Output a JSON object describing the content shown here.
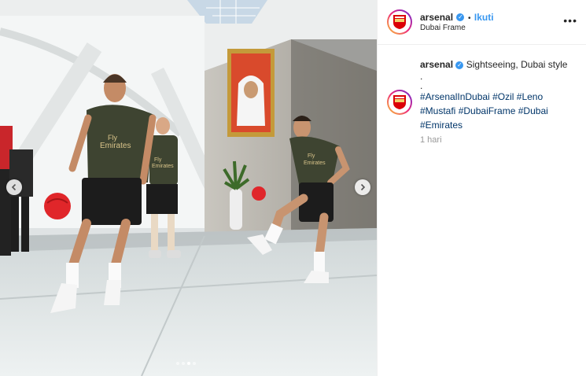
{
  "post": {
    "account": "arsenal",
    "verified_symbol": "✓",
    "separator": "•",
    "follow_label": "Ikuti",
    "location": "Dubai Frame",
    "more_symbol": "•••",
    "caption": {
      "author": "arsenal",
      "text": "Sightseeing, Dubai style",
      "dot1": ".",
      "dot2": "."
    },
    "comment": {
      "hashtags": [
        "#ArsenalInDubai",
        "#Ozil",
        "#Leno",
        "#Mustafi",
        "#DubaiFrame",
        "#Dubai",
        "#Emirates"
      ]
    },
    "timestamp": "1 hari"
  },
  "photo": {
    "shirt_sponsor_1": "Fly",
    "shirt_sponsor_2": "Emirates",
    "shirt_sponsor_3": "Fly",
    "shirt_sponsor_4": "Emirates",
    "carousel": {
      "count": 4,
      "active_index": 2
    }
  },
  "icons": {
    "prev": "chevron-left-icon",
    "next": "chevron-right-icon",
    "crest": "arsenal-crest-icon"
  },
  "colors": {
    "link": "#3897f0",
    "hashtag": "#003569",
    "kit": "#3e4431",
    "ball": "#e0262a"
  }
}
